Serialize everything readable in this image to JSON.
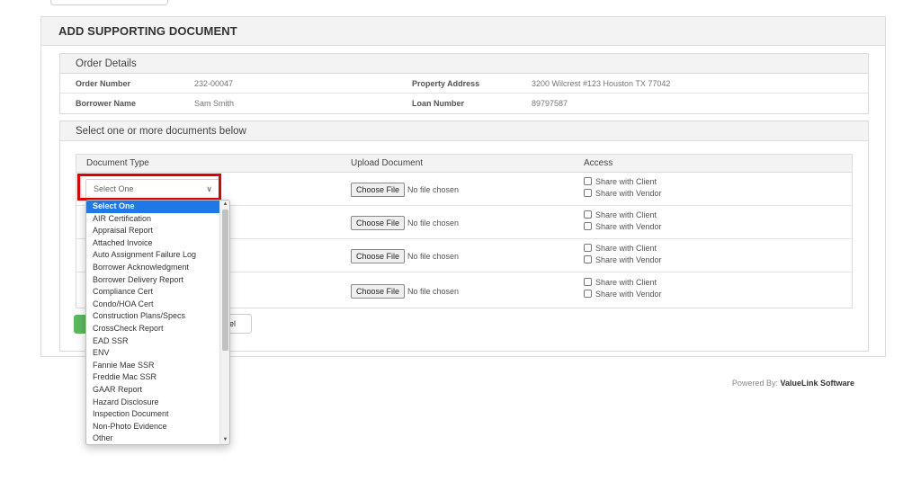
{
  "panel": {
    "title": "ADD SUPPORTING DOCUMENT"
  },
  "order_details": {
    "header": "Order Details",
    "order_number_label": "Order Number",
    "order_number": "232-00047",
    "property_address_label": "Property Address",
    "property_address": "3200 Wilcrest #123 Houston TX 77042",
    "borrower_name_label": "Borrower Name",
    "borrower_name": "Sam Smith",
    "loan_number_label": "Loan Number",
    "loan_number": "89797587"
  },
  "documents": {
    "header": "Select one or more documents below",
    "col_type": "Document Type",
    "col_upload": "Upload Document",
    "col_access": "Access",
    "select_placeholder": "Select One",
    "choose_file_label": "Choose File",
    "no_file_text": "No file chosen",
    "share_client_label": "Share with Client",
    "share_vendor_label": "Share with Vendor"
  },
  "buttons": {
    "cancel_partial": "el"
  },
  "dropdown": {
    "options": [
      "Select One",
      "AIR Certification",
      "Appraisal Report",
      "Attached Invoice",
      "Auto Assignment Failure Log",
      "Borrower Acknowledgment",
      "Borrower Delivery Report",
      "Compliance Cert",
      "Condo/HOA Cert",
      "Construction Plans/Specs",
      "CrossCheck Report",
      "EAD SSR",
      "ENV",
      "Fannie Mae SSR",
      "Freddie Mac SSR",
      "GAAR Report",
      "Hazard Disclosure",
      "Inspection Document",
      "Non-Photo Evidence",
      "Other"
    ],
    "selected": "Select One"
  },
  "footer": {
    "powered_prefix": "Powered By:",
    "brand": "ValueLink Software"
  },
  "colors": {
    "highlight": "#e00000",
    "selected_option": "#1e78e6",
    "save_button": "#5cb85c"
  }
}
